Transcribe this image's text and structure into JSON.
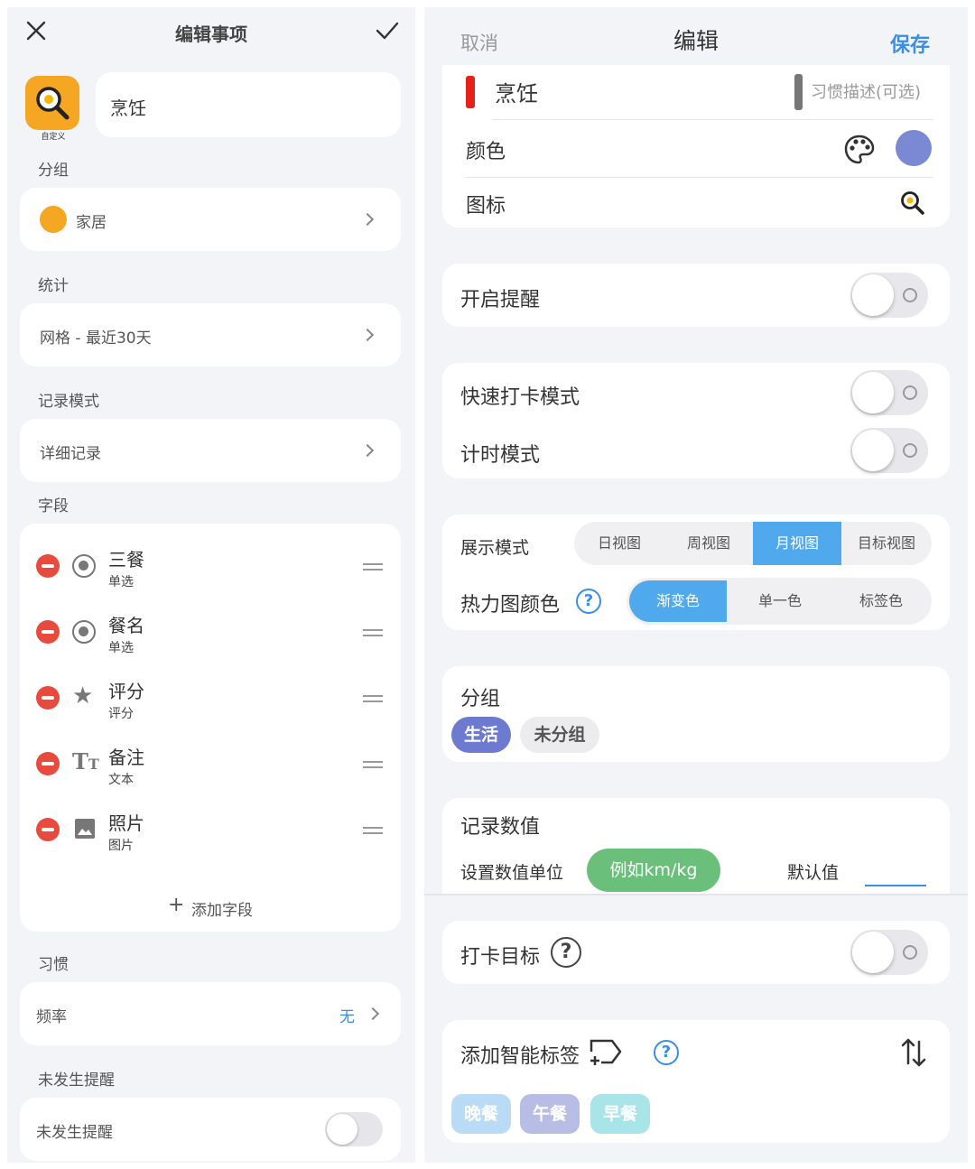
{
  "left": {
    "title": "编辑事项",
    "name_value": "烹饪",
    "icon_caption": "自定义",
    "group": {
      "label": "分组",
      "value": "家居",
      "dot_color": "#f5a623"
    },
    "stats": {
      "label": "统计",
      "value": "网格 - 最近30天"
    },
    "record_mode": {
      "label": "记录模式",
      "value": "详细记录"
    },
    "fields": {
      "label": "字段",
      "items": [
        {
          "name": "三餐",
          "type": "单选",
          "icon": "radio-icon"
        },
        {
          "name": "餐名",
          "type": "单选",
          "icon": "radio-icon"
        },
        {
          "name": "评分",
          "type": "评分",
          "icon": "star-icon"
        },
        {
          "name": "备注",
          "type": "文本",
          "icon": "text-icon"
        },
        {
          "name": "照片",
          "type": "图片",
          "icon": "image-icon"
        }
      ],
      "add_label": "添加字段"
    },
    "habit": {
      "label": "习惯",
      "freq_label": "频率",
      "freq_value": "无"
    },
    "reminder": {
      "label": "未发生提醒",
      "row_label": "未发生提醒"
    }
  },
  "right": {
    "cancel": "取消",
    "title": "编辑",
    "save": "保存",
    "name_value": "烹饪",
    "desc_placeholder": "习惯描述(可选)",
    "color_label": "颜色",
    "color_value": "#7b88d4",
    "icon_label": "图标",
    "reminder_label": "开启提醒",
    "quick_label": "快速打卡模式",
    "timer_label": "计时模式",
    "display": {
      "label": "展示模式",
      "options": [
        "日视图",
        "周视图",
        "月视图",
        "目标视图"
      ],
      "selected": "月视图"
    },
    "heatmap": {
      "label": "热力图颜色",
      "options": [
        "渐变色",
        "单一色",
        "标签色"
      ],
      "selected": "渐变色"
    },
    "group": {
      "label": "分组",
      "chips": [
        "生活",
        "未分组"
      ]
    },
    "record": {
      "label": "记录数值",
      "unit_label": "设置数值单位",
      "unit_placeholder": "例如km/kg",
      "default_label": "默认值"
    },
    "goal_label": "打卡目标",
    "smart": {
      "label": "添加智能标签",
      "tags": [
        "晚餐",
        "午餐",
        "早餐"
      ]
    },
    "accent": "#3a8ee6"
  }
}
